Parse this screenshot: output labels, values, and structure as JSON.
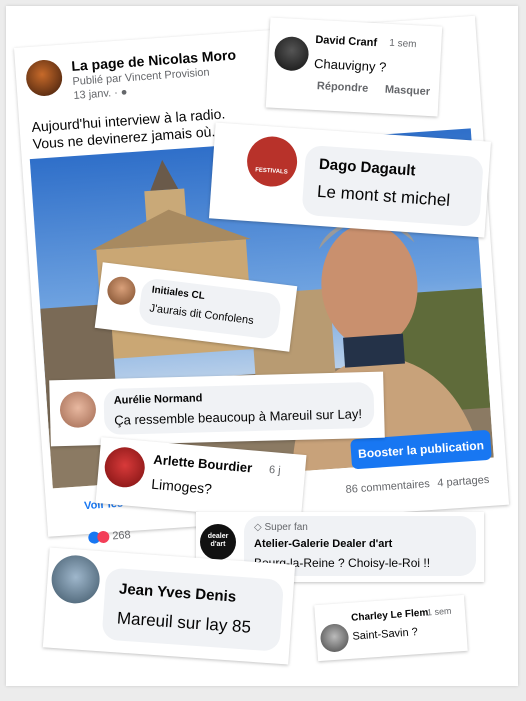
{
  "post": {
    "page_name": "La page de Nicolas Moro",
    "published_by": "Publié par Vincent Provision",
    "date": "13 janv.",
    "text_line1": "Aujourd'hui interview à la radio.",
    "text_line2": "Vous ne devinerez jamais où.",
    "boost_button": "Booster la publication",
    "comments_count": "86 commentaires",
    "shares_count": "4 partages",
    "reactions_count": "268",
    "see_insights": "Voir les"
  },
  "comments": {
    "david": {
      "name": "David Cranf",
      "time": "1 sem",
      "text": "Chauvigny ?",
      "reply": "Répondre",
      "hide": "Masquer"
    },
    "dago": {
      "name": "Dago Dagault",
      "text": "Le mont st michel",
      "badge": "FESTIVALS"
    },
    "initiales": {
      "name": "Initiales CL",
      "text": "J'aurais dit Confolens"
    },
    "aurelie": {
      "name": "Aurélie Normand",
      "text": "Ça ressemble beaucoup à Mareuil sur Lay!"
    },
    "arlette": {
      "name": "Arlette Bourdier",
      "time": "6 j",
      "text": "Limoges?"
    },
    "dealer": {
      "fan": "Super fan",
      "name": "Atelier-Galerie Dealer d'art",
      "text": "Bourg-la-Reine ? Choisy-le-Roi !!",
      "logo_line1": "dealer",
      "logo_line2": "d'art"
    },
    "jean": {
      "name": "Jean Yves Denis",
      "text": "Mareuil sur lay 85"
    },
    "charley": {
      "name": "Charley Le Flem",
      "time": "1 sem",
      "text": "Saint-Savin ?"
    }
  },
  "colors": {
    "facebook_blue": "#1877f2",
    "text": "#050505",
    "muted": "#65676b",
    "bubble": "#f0f2f5"
  }
}
